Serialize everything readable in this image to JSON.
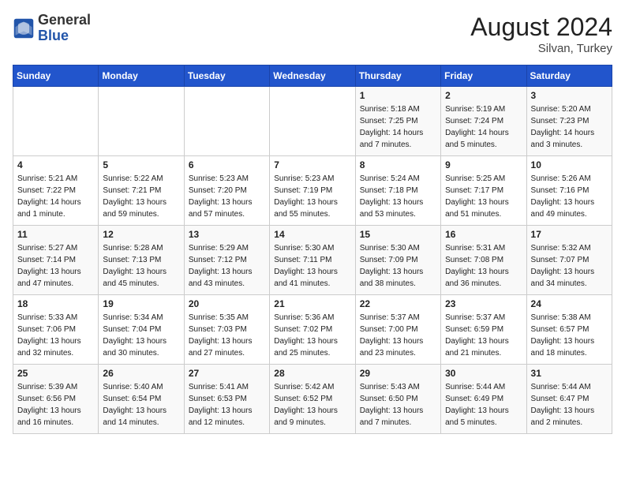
{
  "header": {
    "logo_general": "General",
    "logo_blue": "Blue",
    "month_year": "August 2024",
    "location": "Silvan, Turkey"
  },
  "weekdays": [
    "Sunday",
    "Monday",
    "Tuesday",
    "Wednesday",
    "Thursday",
    "Friday",
    "Saturday"
  ],
  "weeks": [
    [
      {
        "day": "",
        "info": ""
      },
      {
        "day": "",
        "info": ""
      },
      {
        "day": "",
        "info": ""
      },
      {
        "day": "",
        "info": ""
      },
      {
        "day": "1",
        "info": "Sunrise: 5:18 AM\nSunset: 7:25 PM\nDaylight: 14 hours\nand 7 minutes."
      },
      {
        "day": "2",
        "info": "Sunrise: 5:19 AM\nSunset: 7:24 PM\nDaylight: 14 hours\nand 5 minutes."
      },
      {
        "day": "3",
        "info": "Sunrise: 5:20 AM\nSunset: 7:23 PM\nDaylight: 14 hours\nand 3 minutes."
      }
    ],
    [
      {
        "day": "4",
        "info": "Sunrise: 5:21 AM\nSunset: 7:22 PM\nDaylight: 14 hours\nand 1 minute."
      },
      {
        "day": "5",
        "info": "Sunrise: 5:22 AM\nSunset: 7:21 PM\nDaylight: 13 hours\nand 59 minutes."
      },
      {
        "day": "6",
        "info": "Sunrise: 5:23 AM\nSunset: 7:20 PM\nDaylight: 13 hours\nand 57 minutes."
      },
      {
        "day": "7",
        "info": "Sunrise: 5:23 AM\nSunset: 7:19 PM\nDaylight: 13 hours\nand 55 minutes."
      },
      {
        "day": "8",
        "info": "Sunrise: 5:24 AM\nSunset: 7:18 PM\nDaylight: 13 hours\nand 53 minutes."
      },
      {
        "day": "9",
        "info": "Sunrise: 5:25 AM\nSunset: 7:17 PM\nDaylight: 13 hours\nand 51 minutes."
      },
      {
        "day": "10",
        "info": "Sunrise: 5:26 AM\nSunset: 7:16 PM\nDaylight: 13 hours\nand 49 minutes."
      }
    ],
    [
      {
        "day": "11",
        "info": "Sunrise: 5:27 AM\nSunset: 7:14 PM\nDaylight: 13 hours\nand 47 minutes."
      },
      {
        "day": "12",
        "info": "Sunrise: 5:28 AM\nSunset: 7:13 PM\nDaylight: 13 hours\nand 45 minutes."
      },
      {
        "day": "13",
        "info": "Sunrise: 5:29 AM\nSunset: 7:12 PM\nDaylight: 13 hours\nand 43 minutes."
      },
      {
        "day": "14",
        "info": "Sunrise: 5:30 AM\nSunset: 7:11 PM\nDaylight: 13 hours\nand 41 minutes."
      },
      {
        "day": "15",
        "info": "Sunrise: 5:30 AM\nSunset: 7:09 PM\nDaylight: 13 hours\nand 38 minutes."
      },
      {
        "day": "16",
        "info": "Sunrise: 5:31 AM\nSunset: 7:08 PM\nDaylight: 13 hours\nand 36 minutes."
      },
      {
        "day": "17",
        "info": "Sunrise: 5:32 AM\nSunset: 7:07 PM\nDaylight: 13 hours\nand 34 minutes."
      }
    ],
    [
      {
        "day": "18",
        "info": "Sunrise: 5:33 AM\nSunset: 7:06 PM\nDaylight: 13 hours\nand 32 minutes."
      },
      {
        "day": "19",
        "info": "Sunrise: 5:34 AM\nSunset: 7:04 PM\nDaylight: 13 hours\nand 30 minutes."
      },
      {
        "day": "20",
        "info": "Sunrise: 5:35 AM\nSunset: 7:03 PM\nDaylight: 13 hours\nand 27 minutes."
      },
      {
        "day": "21",
        "info": "Sunrise: 5:36 AM\nSunset: 7:02 PM\nDaylight: 13 hours\nand 25 minutes."
      },
      {
        "day": "22",
        "info": "Sunrise: 5:37 AM\nSunset: 7:00 PM\nDaylight: 13 hours\nand 23 minutes."
      },
      {
        "day": "23",
        "info": "Sunrise: 5:37 AM\nSunset: 6:59 PM\nDaylight: 13 hours\nand 21 minutes."
      },
      {
        "day": "24",
        "info": "Sunrise: 5:38 AM\nSunset: 6:57 PM\nDaylight: 13 hours\nand 18 minutes."
      }
    ],
    [
      {
        "day": "25",
        "info": "Sunrise: 5:39 AM\nSunset: 6:56 PM\nDaylight: 13 hours\nand 16 minutes."
      },
      {
        "day": "26",
        "info": "Sunrise: 5:40 AM\nSunset: 6:54 PM\nDaylight: 13 hours\nand 14 minutes."
      },
      {
        "day": "27",
        "info": "Sunrise: 5:41 AM\nSunset: 6:53 PM\nDaylight: 13 hours\nand 12 minutes."
      },
      {
        "day": "28",
        "info": "Sunrise: 5:42 AM\nSunset: 6:52 PM\nDaylight: 13 hours\nand 9 minutes."
      },
      {
        "day": "29",
        "info": "Sunrise: 5:43 AM\nSunset: 6:50 PM\nDaylight: 13 hours\nand 7 minutes."
      },
      {
        "day": "30",
        "info": "Sunrise: 5:44 AM\nSunset: 6:49 PM\nDaylight: 13 hours\nand 5 minutes."
      },
      {
        "day": "31",
        "info": "Sunrise: 5:44 AM\nSunset: 6:47 PM\nDaylight: 13 hours\nand 2 minutes."
      }
    ]
  ]
}
